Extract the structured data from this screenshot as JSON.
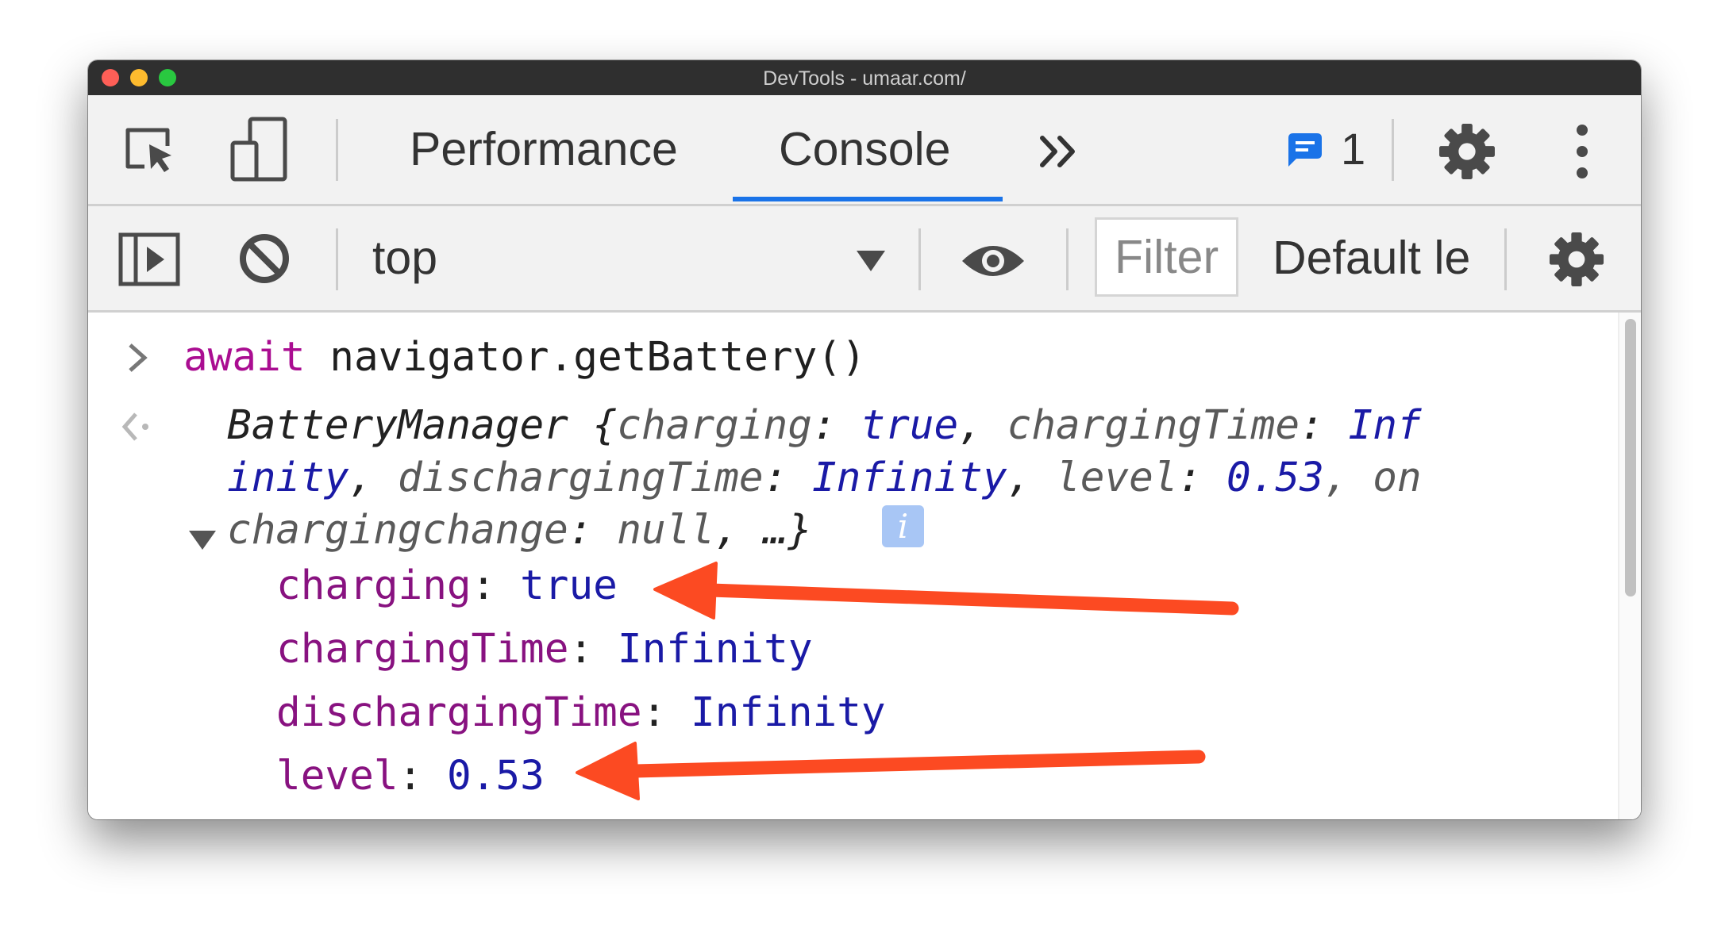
{
  "window": {
    "title": "DevTools - umaar.com/"
  },
  "toolbar": {
    "inspect_icon": "inspect-element-icon",
    "device_icon": "device-toolbar-icon",
    "tabs": [
      {
        "label": "Performance",
        "active": false
      },
      {
        "label": "Console",
        "active": true
      }
    ],
    "more_tabs_icon": "double-chevron-right-icon",
    "issues_icon": "message-icon",
    "issues_count": "1",
    "settings_icon": "gear-icon",
    "menu_icon": "vertical-dots-icon"
  },
  "console_toolbar": {
    "sidebar_icon": "sidebar-toggle-icon",
    "clear_icon": "clear-console-icon",
    "context": "top",
    "live_expression_icon": "eye-icon",
    "filter_placeholder": "Filter",
    "levels_label": "Default le",
    "settings_icon": "gear-icon"
  },
  "console": {
    "input": {
      "keyword": "await",
      "code": " navigator.getBattery()"
    },
    "result": {
      "summary_line1": [
        "BatteryManager ",
        "{",
        "charging",
        ": ",
        "true",
        ", ",
        "chargingTime",
        ": ",
        "Inf"
      ],
      "summary_line2": [
        "inity",
        ", ",
        "dischargingTime",
        ": ",
        "Infinity",
        ", ",
        "level",
        ": ",
        "0.53",
        ", on"
      ],
      "summary_line3": [
        "chargingchange",
        ": ",
        "null",
        ", …}"
      ],
      "info_badge": "i",
      "properties": [
        {
          "name": "charging",
          "value": "true"
        },
        {
          "name": "chargingTime",
          "value": "Infinity"
        },
        {
          "name": "dischargingTime",
          "value": "Infinity"
        },
        {
          "name": "level",
          "value": "0.53"
        }
      ]
    }
  },
  "annotations": {
    "arrow_color": "#fc4a22"
  },
  "colors": {
    "accent": "#1a73e8",
    "property_name": "#881280",
    "property_value": "#1a1aa6",
    "keyword": "#aa0d91"
  }
}
